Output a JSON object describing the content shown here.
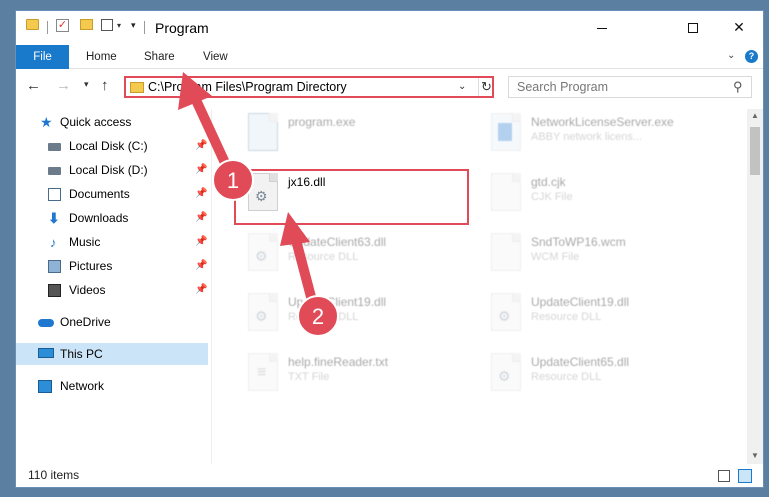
{
  "window": {
    "title": "Program",
    "controls": {
      "minimize": "—",
      "maximize": "☐",
      "close": "✕"
    }
  },
  "ribbon": {
    "tabs": [
      "File",
      "Home",
      "Share",
      "View"
    ]
  },
  "nav": {
    "address": "C:\\Program Files\\Program Directory",
    "search_placeholder": "Search Program"
  },
  "sidebar": {
    "items": [
      {
        "label": "Quick access",
        "icon": "star-icon",
        "pinned": false
      },
      {
        "label": "Local Disk (C:)",
        "icon": "drive-icon",
        "pinned": true
      },
      {
        "label": "Local Disk (D:)",
        "icon": "drive-icon",
        "pinned": true
      },
      {
        "label": "Documents",
        "icon": "documents-icon",
        "pinned": true
      },
      {
        "label": "Downloads",
        "icon": "download-icon",
        "pinned": true
      },
      {
        "label": "Music",
        "icon": "music-icon",
        "pinned": true
      },
      {
        "label": "Pictures",
        "icon": "pictures-icon",
        "pinned": true
      },
      {
        "label": "Videos",
        "icon": "videos-icon",
        "pinned": true
      },
      {
        "label": "OneDrive",
        "icon": "cloud-icon",
        "pinned": false
      },
      {
        "label": "This PC",
        "icon": "computer-icon",
        "pinned": false,
        "selected": true
      },
      {
        "label": "Network",
        "icon": "network-icon",
        "pinned": false
      }
    ]
  },
  "files": [
    {
      "name": "program.exe",
      "type": "",
      "icon": "exe-icon",
      "faded": true
    },
    {
      "name": "NetworkLicenseServer.exe",
      "type": "ABBY network licens...",
      "icon": "exe-icon",
      "faded": true
    },
    {
      "name": "jx16.dll",
      "type": "",
      "icon": "dll-icon",
      "faded": false
    },
    {
      "name": "gtd.cjk",
      "type": "CJK File",
      "icon": "file-icon",
      "faded": true
    },
    {
      "name": "UpdateClient63.dll",
      "type": "Resource DLL",
      "icon": "dll-icon",
      "faded": true
    },
    {
      "name": "SndToWP16.wcm",
      "type": "WCM File",
      "icon": "file-icon",
      "faded": true
    },
    {
      "name": "UpdateClient19.dll",
      "type": "Resource DLL",
      "icon": "dll-icon",
      "faded": true
    },
    {
      "name": "UpdateClient19.dll",
      "type": "Resource DLL",
      "icon": "dll-icon",
      "faded": true
    },
    {
      "name": "help.fineReader.txt",
      "type": "TXT File",
      "icon": "text-icon",
      "faded": true
    },
    {
      "name": "UpdateClient65.dll",
      "type": "Resource DLL",
      "icon": "dll-icon",
      "faded": true
    }
  ],
  "status": {
    "item_count": "110 items"
  },
  "annotations": {
    "step1": "1",
    "step2": "2",
    "accent_color": "#e04b57"
  }
}
